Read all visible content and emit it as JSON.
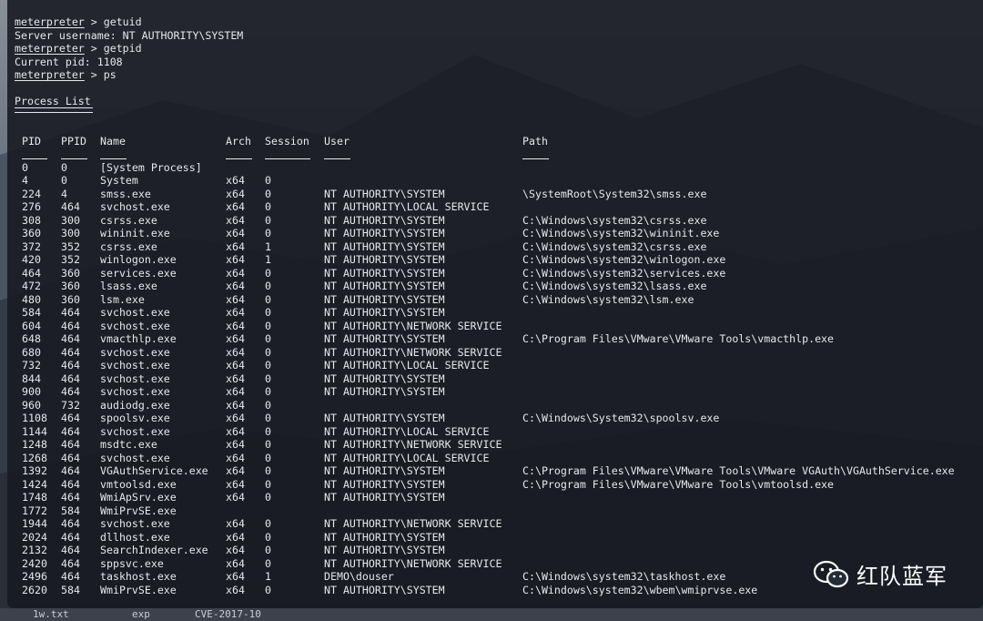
{
  "terminal": {
    "prompt": "meterpreter",
    "commands": [
      {
        "cmd": "getuid"
      },
      {
        "output": "Server username: NT AUTHORITY\\SYSTEM"
      },
      {
        "cmd": "getpid"
      },
      {
        "output": "Current pid: 1108"
      },
      {
        "cmd": "ps"
      }
    ],
    "process_list_title": "Process List",
    "headers": {
      "pid": "PID",
      "ppid": "PPID",
      "name": "Name",
      "arch": "Arch",
      "session": "Session",
      "user": "User",
      "path": "Path"
    },
    "processes": [
      {
        "pid": "0",
        "ppid": "0",
        "name": "[System Process]",
        "arch": "",
        "session": "",
        "user": "",
        "path": ""
      },
      {
        "pid": "4",
        "ppid": "0",
        "name": "System",
        "arch": "x64",
        "session": "0",
        "user": "",
        "path": ""
      },
      {
        "pid": "224",
        "ppid": "4",
        "name": "smss.exe",
        "arch": "x64",
        "session": "0",
        "user": "NT AUTHORITY\\SYSTEM",
        "path": "\\SystemRoot\\System32\\smss.exe"
      },
      {
        "pid": "276",
        "ppid": "464",
        "name": "svchost.exe",
        "arch": "x64",
        "session": "0",
        "user": "NT AUTHORITY\\LOCAL SERVICE",
        "path": ""
      },
      {
        "pid": "308",
        "ppid": "300",
        "name": "csrss.exe",
        "arch": "x64",
        "session": "0",
        "user": "NT AUTHORITY\\SYSTEM",
        "path": "C:\\Windows\\system32\\csrss.exe"
      },
      {
        "pid": "360",
        "ppid": "300",
        "name": "wininit.exe",
        "arch": "x64",
        "session": "0",
        "user": "NT AUTHORITY\\SYSTEM",
        "path": "C:\\Windows\\system32\\wininit.exe"
      },
      {
        "pid": "372",
        "ppid": "352",
        "name": "csrss.exe",
        "arch": "x64",
        "session": "1",
        "user": "NT AUTHORITY\\SYSTEM",
        "path": "C:\\Windows\\system32\\csrss.exe"
      },
      {
        "pid": "420",
        "ppid": "352",
        "name": "winlogon.exe",
        "arch": "x64",
        "session": "1",
        "user": "NT AUTHORITY\\SYSTEM",
        "path": "C:\\Windows\\system32\\winlogon.exe"
      },
      {
        "pid": "464",
        "ppid": "360",
        "name": "services.exe",
        "arch": "x64",
        "session": "0",
        "user": "NT AUTHORITY\\SYSTEM",
        "path": "C:\\Windows\\system32\\services.exe"
      },
      {
        "pid": "472",
        "ppid": "360",
        "name": "lsass.exe",
        "arch": "x64",
        "session": "0",
        "user": "NT AUTHORITY\\SYSTEM",
        "path": "C:\\Windows\\system32\\lsass.exe"
      },
      {
        "pid": "480",
        "ppid": "360",
        "name": "lsm.exe",
        "arch": "x64",
        "session": "0",
        "user": "NT AUTHORITY\\SYSTEM",
        "path": "C:\\Windows\\system32\\lsm.exe"
      },
      {
        "pid": "584",
        "ppid": "464",
        "name": "svchost.exe",
        "arch": "x64",
        "session": "0",
        "user": "NT AUTHORITY\\SYSTEM",
        "path": ""
      },
      {
        "pid": "604",
        "ppid": "464",
        "name": "svchost.exe",
        "arch": "x64",
        "session": "0",
        "user": "NT AUTHORITY\\NETWORK SERVICE",
        "path": ""
      },
      {
        "pid": "648",
        "ppid": "464",
        "name": "vmacthlp.exe",
        "arch": "x64",
        "session": "0",
        "user": "NT AUTHORITY\\SYSTEM",
        "path": "C:\\Program Files\\VMware\\VMware Tools\\vmacthlp.exe"
      },
      {
        "pid": "680",
        "ppid": "464",
        "name": "svchost.exe",
        "arch": "x64",
        "session": "0",
        "user": "NT AUTHORITY\\NETWORK SERVICE",
        "path": ""
      },
      {
        "pid": "732",
        "ppid": "464",
        "name": "svchost.exe",
        "arch": "x64",
        "session": "0",
        "user": "NT AUTHORITY\\LOCAL SERVICE",
        "path": ""
      },
      {
        "pid": "844",
        "ppid": "464",
        "name": "svchost.exe",
        "arch": "x64",
        "session": "0",
        "user": "NT AUTHORITY\\SYSTEM",
        "path": ""
      },
      {
        "pid": "900",
        "ppid": "464",
        "name": "svchost.exe",
        "arch": "x64",
        "session": "0",
        "user": "NT AUTHORITY\\SYSTEM",
        "path": ""
      },
      {
        "pid": "960",
        "ppid": "732",
        "name": "audiodg.exe",
        "arch": "x64",
        "session": "0",
        "user": "",
        "path": ""
      },
      {
        "pid": "1108",
        "ppid": "464",
        "name": "spoolsv.exe",
        "arch": "x64",
        "session": "0",
        "user": "NT AUTHORITY\\SYSTEM",
        "path": "C:\\Windows\\System32\\spoolsv.exe"
      },
      {
        "pid": "1144",
        "ppid": "464",
        "name": "svchost.exe",
        "arch": "x64",
        "session": "0",
        "user": "NT AUTHORITY\\LOCAL SERVICE",
        "path": ""
      },
      {
        "pid": "1248",
        "ppid": "464",
        "name": "msdtc.exe",
        "arch": "x64",
        "session": "0",
        "user": "NT AUTHORITY\\NETWORK SERVICE",
        "path": ""
      },
      {
        "pid": "1268",
        "ppid": "464",
        "name": "svchost.exe",
        "arch": "x64",
        "session": "0",
        "user": "NT AUTHORITY\\LOCAL SERVICE",
        "path": ""
      },
      {
        "pid": "1392",
        "ppid": "464",
        "name": "VGAuthService.exe",
        "arch": "x64",
        "session": "0",
        "user": "NT AUTHORITY\\SYSTEM",
        "path": "C:\\Program Files\\VMware\\VMware Tools\\VMware VGAuth\\VGAuthService.exe"
      },
      {
        "pid": "1424",
        "ppid": "464",
        "name": "vmtoolsd.exe",
        "arch": "x64",
        "session": "0",
        "user": "NT AUTHORITY\\SYSTEM",
        "path": "C:\\Program Files\\VMware\\VMware Tools\\vmtoolsd.exe"
      },
      {
        "pid": "1748",
        "ppid": "464",
        "name": "WmiApSrv.exe",
        "arch": "x64",
        "session": "0",
        "user": "NT AUTHORITY\\SYSTEM",
        "path": ""
      },
      {
        "pid": "1772",
        "ppid": "584",
        "name": "WmiPrvSE.exe",
        "arch": "",
        "session": "",
        "user": "",
        "path": ""
      },
      {
        "pid": "1944",
        "ppid": "464",
        "name": "svchost.exe",
        "arch": "x64",
        "session": "0",
        "user": "NT AUTHORITY\\NETWORK SERVICE",
        "path": ""
      },
      {
        "pid": "2024",
        "ppid": "464",
        "name": "dllhost.exe",
        "arch": "x64",
        "session": "0",
        "user": "NT AUTHORITY\\SYSTEM",
        "path": ""
      },
      {
        "pid": "2132",
        "ppid": "464",
        "name": "SearchIndexer.exe",
        "arch": "x64",
        "session": "0",
        "user": "NT AUTHORITY\\SYSTEM",
        "path": ""
      },
      {
        "pid": "2420",
        "ppid": "464",
        "name": "sppsvc.exe",
        "arch": "x64",
        "session": "0",
        "user": "NT AUTHORITY\\NETWORK SERVICE",
        "path": ""
      },
      {
        "pid": "2496",
        "ppid": "464",
        "name": "taskhost.exe",
        "arch": "x64",
        "session": "1",
        "user": "DEMO\\douser",
        "path": "C:\\Windows\\system32\\taskhost.exe"
      },
      {
        "pid": "2620",
        "ppid": "584",
        "name": "WmiPrvSE.exe",
        "arch": "x64",
        "session": "0",
        "user": "NT AUTHORITY\\SYSTEM",
        "path": "C:\\Windows\\system32\\wbem\\wmiprvse.exe"
      }
    ]
  },
  "bottom_strip": {
    "items": [
      "1w.txt",
      "exp",
      "CVE-2017-10"
    ]
  },
  "watermark": {
    "text": "红队蓝军",
    "icon": "wechat-icon"
  },
  "colors": {
    "terminal_bg": "#181b24",
    "text": "#e6e8ee"
  }
}
